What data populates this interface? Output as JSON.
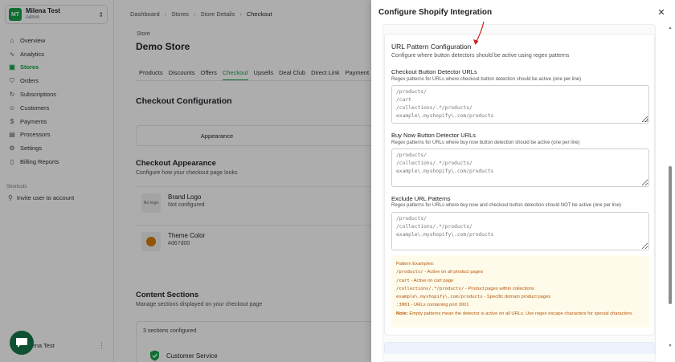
{
  "sidebar": {
    "user": {
      "initials": "MT",
      "name": "Milena Test",
      "role": "Admin"
    },
    "items": [
      {
        "label": "Overview",
        "icon": "home-icon",
        "glyph": "⌂"
      },
      {
        "label": "Analytics",
        "icon": "chart-icon",
        "glyph": "∿"
      },
      {
        "label": "Stores",
        "icon": "store-icon",
        "glyph": "▣",
        "active": true
      },
      {
        "label": "Orders",
        "icon": "cart-icon",
        "glyph": "⛉"
      },
      {
        "label": "Subscriptions",
        "icon": "refresh-icon",
        "glyph": "↻"
      },
      {
        "label": "Customers",
        "icon": "users-icon",
        "glyph": "☺"
      },
      {
        "label": "Payments",
        "icon": "payment-icon",
        "glyph": "$"
      },
      {
        "label": "Processors",
        "icon": "processor-icon",
        "glyph": "▤"
      },
      {
        "label": "Settings",
        "icon": "gear-icon",
        "glyph": "⚙"
      },
      {
        "label": "Billing Reports",
        "icon": "file-icon",
        "glyph": "▯"
      }
    ],
    "shortcuts_title": "Shortcuts",
    "shortcut_invite": "Invite user to account",
    "bottom_user": "Milena Test"
  },
  "breadcrumb": [
    "Dashboard",
    "Stores",
    "Store Details",
    "Checkout"
  ],
  "store": {
    "label": "Store",
    "title": "Demo Store"
  },
  "tabs": [
    "Products",
    "Discounts",
    "Offers",
    "Checkout",
    "Upsells",
    "Deal Club",
    "Direct Link",
    "Payment"
  ],
  "checkout": {
    "config_title": "Checkout Configuration",
    "segment_appearance": "Appearance",
    "appearance_title": "Checkout Appearance",
    "appearance_sub": "Configure how your checkout page looks",
    "brand_logo_title": "Brand Logo",
    "brand_logo_sub": "Not configured",
    "no_logo": "No logo",
    "theme_color_title": "Theme Color",
    "theme_color_value": "#d67d00",
    "content_title": "Content Sections",
    "content_sub": "Manage sections displayed on your checkout page",
    "sections_count": "3 sections configured",
    "customer_service": "Customer Service"
  },
  "modal": {
    "title": "Configure Shopify Integration",
    "url_config_title": "URL Pattern Configuration",
    "url_config_sub": "Configure where button detectors should be active using regex patterns",
    "checkout_label": "Checkout Button Detector URLs",
    "checkout_help": "Regex patterns for URLs where checkout button detection should be active (one per line)",
    "checkout_placeholder": "/products/\n/cart\n/collections/.*/products/\nexample\\.myshopify\\.com/products",
    "buynow_label": "Buy Now Button Detector URLs",
    "buynow_help": "Regex patterns for URLs where buy now button detection should be active (one per line)",
    "buynow_placeholder": "/products/\n/collections/.*/products/\nexample\\.myshopify\\.com/products",
    "exclude_label": "Exclude URL Patterns",
    "exclude_help": "Regex patterns for URLs where buy now and checkout button detection should NOT be active (one per line)",
    "exclude_placeholder": "/products/\n/collections/.*/products/\nexample\\.myshopify\\.com/products",
    "examples_title": "Pattern Examples:",
    "examples": [
      {
        "code": "/products/",
        "desc": " - Active on all product pages"
      },
      {
        "code": "/cart",
        "desc": " - Active on cart page"
      },
      {
        "code": "/collections/.*/products/",
        "desc": " - Product pages within collections"
      },
      {
        "code": "example\\.myshopify\\.com/products",
        "desc": " - Specific domain product pages"
      },
      {
        "code": ":3001",
        "desc": " - URLs containing port 3001"
      }
    ],
    "note_bold": "Note:",
    "note_text": " Empty patterns mean the detector is active on all URLs. Use regex escape characters for special characters."
  },
  "colors": {
    "accent": "#16a34a",
    "annotation_arrow": "#cc1f1f",
    "example_text": "#b45309",
    "example_bg": "#fffbea"
  }
}
